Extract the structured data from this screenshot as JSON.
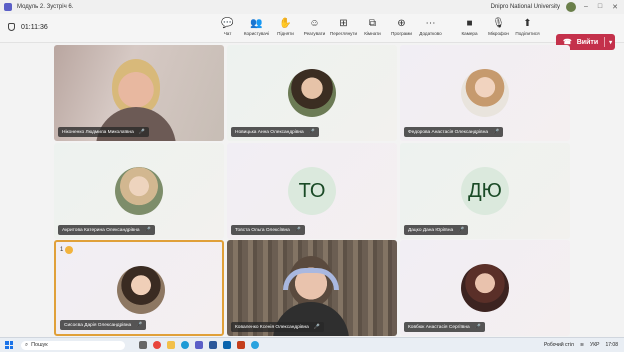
{
  "window": {
    "title": "Модуль 2. Зустріч 6.",
    "org": "Dnipro National University"
  },
  "meeting": {
    "elapsed": "01:11:36"
  },
  "toolbar": [
    {
      "label": "Чат",
      "icon": "chat-icon",
      "glyph": "💬"
    },
    {
      "label": "Користувачі",
      "icon": "people-icon",
      "glyph": "👥",
      "badge": "3"
    },
    {
      "label": "Підняти",
      "icon": "raise-hand-icon",
      "glyph": "✋"
    },
    {
      "label": "Реагувати",
      "icon": "react-icon",
      "glyph": "☺"
    },
    {
      "label": "Переглянути",
      "icon": "view-icon",
      "glyph": "⊞"
    },
    {
      "label": "Кімнати",
      "icon": "rooms-icon",
      "glyph": "⧉"
    },
    {
      "label": "Програми",
      "icon": "apps-icon",
      "glyph": "⊕"
    },
    {
      "label": "Додатково",
      "icon": "more-icon",
      "glyph": "⋯"
    },
    {
      "label": "Камера",
      "icon": "camera-icon",
      "glyph": "■"
    },
    {
      "label": "Мікрофон",
      "icon": "microphone-icon",
      "glyph": "🎙"
    },
    {
      "label": "Поділитися",
      "icon": "share-icon",
      "glyph": "⬆"
    }
  ],
  "leave": {
    "label": "Вийти"
  },
  "participants": [
    {
      "name": "Ніконенко Людмила Миколаївна",
      "kind": "video-host"
    },
    {
      "name": "Новицька Анна Олександрівна",
      "kind": "photo1"
    },
    {
      "name": "Федорова Анастасія Олександрівна",
      "kind": "photo2"
    },
    {
      "name": "Акритова Катерина Олександрівна",
      "kind": "photo3"
    },
    {
      "name": "Товста Ольга Олексіївна",
      "kind": "initials",
      "initials": "ТО"
    },
    {
      "name": "Дацко Дана Юріївна",
      "kind": "initials",
      "initials": "ДЮ"
    },
    {
      "name": "Сисоєва Дарія Олександрівна",
      "kind": "photo4",
      "hand": "1"
    },
    {
      "name": "Коваленко Ксенія Олександрівна",
      "kind": "video-student"
    },
    {
      "name": "Ковбюк Анастасія Сергіївна",
      "kind": "photo5"
    }
  ],
  "taskbar": {
    "search": "Пошук",
    "desktop": "Робочий стіл",
    "lang": "УКР",
    "time": "17:08"
  }
}
